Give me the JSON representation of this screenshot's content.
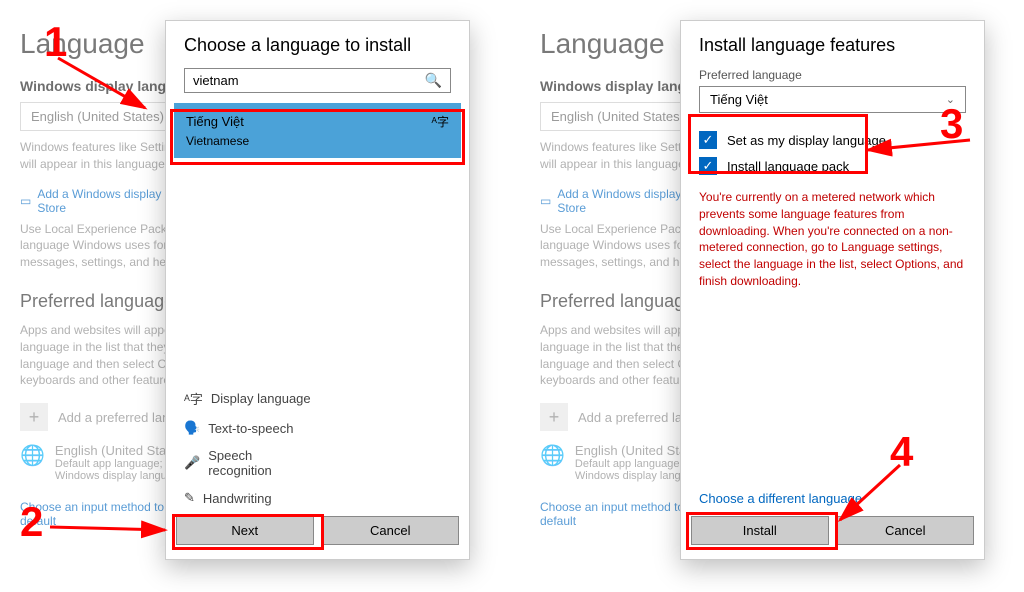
{
  "bg": {
    "title": "Language",
    "displayHeading": "Windows display language",
    "langBox": "English (United States)",
    "featuresLine": "Windows features like Settings and File Explorer will appear in this language.",
    "addLink": "Add a Windows display language in Microsoft Store",
    "lepLine": "Use Local Experience Packs to change the language Windows uses for navigation, menus, messages, settings, and help topics.",
    "prefTitle": "Preferred languages",
    "prefLine": "Apps and websites will appear in the first language in the list that they support. Select a language and then select Options to configure keyboards and other features.",
    "addPref": "Add a preferred language",
    "engTitle": "English (United States)",
    "engSub": "Default app language; Default input language; Windows display language",
    "inputLink": "Choose an input method to always use as default"
  },
  "dialog1": {
    "title": "Choose a language to install",
    "searchValue": "vietnam",
    "result": {
      "native": "Tiếng Việt",
      "eng": "Vietnamese"
    },
    "features": {
      "display": "Display language",
      "tts": "Text-to-speech",
      "speech": "Speech recognition",
      "hand": "Handwriting"
    },
    "next": "Next",
    "cancel": "Cancel"
  },
  "dialog2": {
    "title": "Install language features",
    "prefLabel": "Preferred language",
    "prefValue": "Tiếng Việt",
    "check1": "Set as my display language",
    "check2": "Install language pack",
    "warn": "You're currently on a metered network which prevents some language features from downloading. When you're connected on a non-metered connection, go to Language settings, select the language in the list, select Options, and finish downloading.",
    "diffLink": "Choose a different language",
    "install": "Install",
    "cancel": "Cancel"
  },
  "anno": {
    "n1": "1",
    "n2": "2",
    "n3": "3",
    "n4": "4"
  }
}
